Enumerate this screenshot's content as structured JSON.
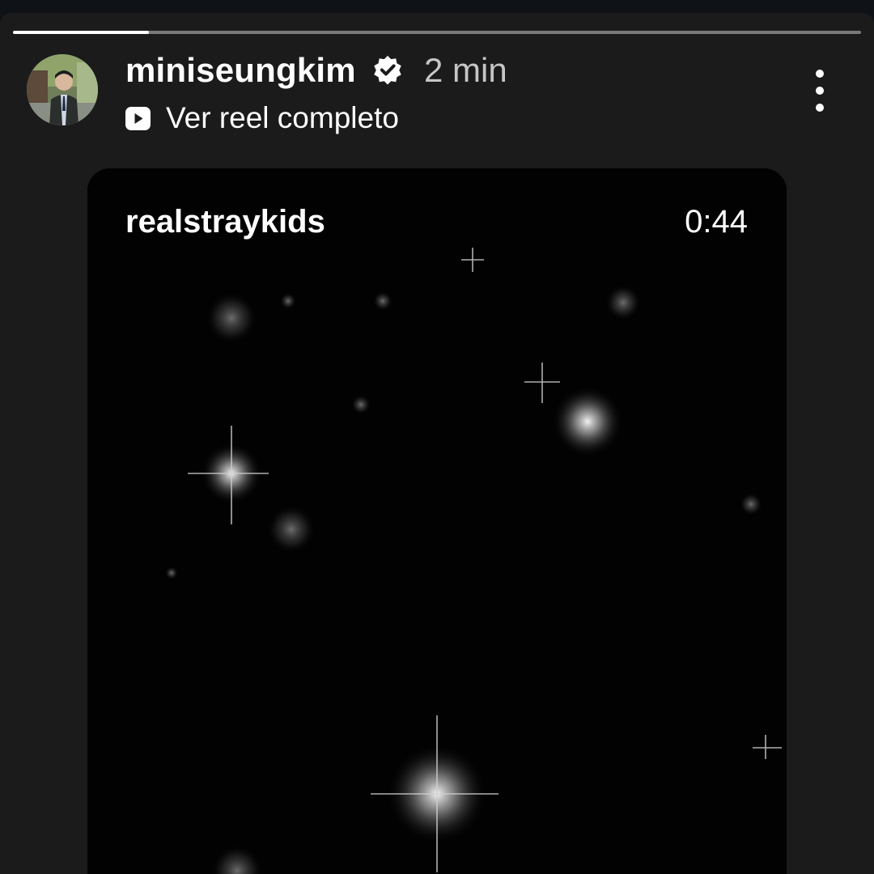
{
  "story": {
    "progress": 0.16,
    "username": "miniseungkim",
    "verified": true,
    "time_ago": "2 min",
    "link_label": "Ver reel completo",
    "link_icon": "play-square-icon",
    "menu_icon": "more-vertical-icon"
  },
  "reel": {
    "username": "realstraykids",
    "duration": "0:44"
  },
  "colors": {
    "background": "#1b1b1b",
    "card": "#000000",
    "text": "#ffffff",
    "muted_text": "#c6c6c6"
  }
}
